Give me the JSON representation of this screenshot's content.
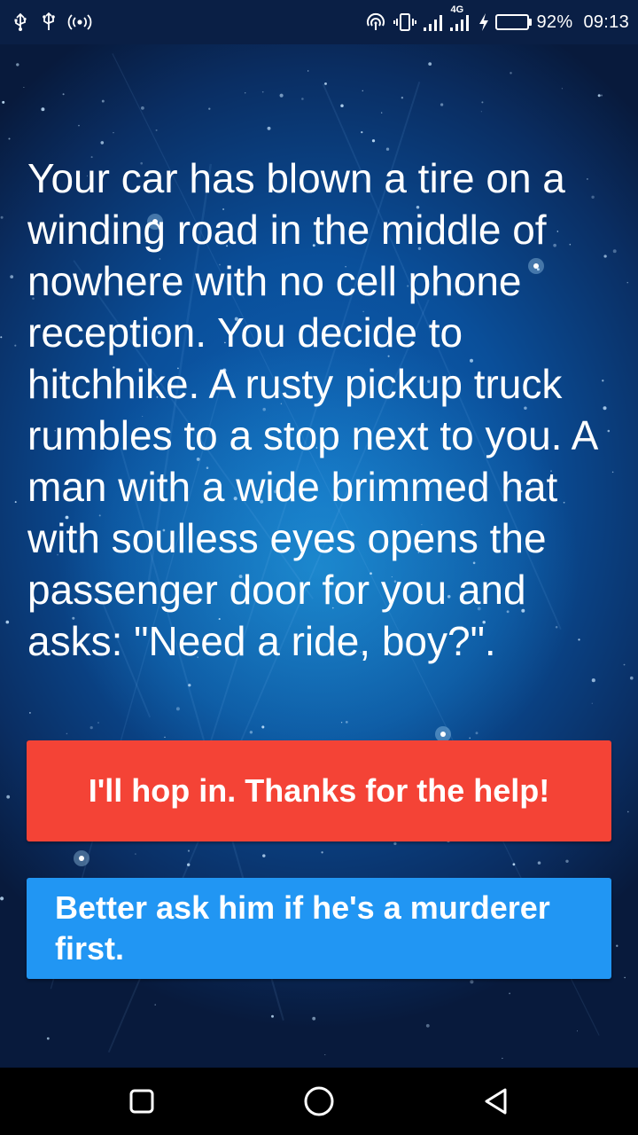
{
  "status_bar": {
    "left_icons": [
      "usb-icon",
      "usb-debug-icon",
      "hotspot-icon"
    ],
    "right_icons": [
      "nfc-icon",
      "vibrate-icon",
      "signal-icon",
      "4g-signal-icon",
      "charging-icon"
    ],
    "network_label": "4G",
    "battery_level": 0.92,
    "battery_text": "92%",
    "time": "09:13",
    "battery_color": "#33d14a"
  },
  "story": {
    "text": "Your car has blown a tire on a winding road in the middle of nowhere with no cell phone reception. You decide to hitchhike. A rusty pickup truck rumbles to a stop next to you. A man with a wide brimmed hat with soulless eyes opens the passenger door for you and asks: \"Need a ride, boy?\"."
  },
  "choices": [
    {
      "label": "I'll hop in. Thanks for the help!",
      "color": "#f44336"
    },
    {
      "label": "Better ask him if he's a murderer first.",
      "color": "#2196f3"
    }
  ],
  "nav_bar": {
    "buttons": [
      "recents-square-icon",
      "home-circle-icon",
      "back-triangle-icon"
    ]
  }
}
